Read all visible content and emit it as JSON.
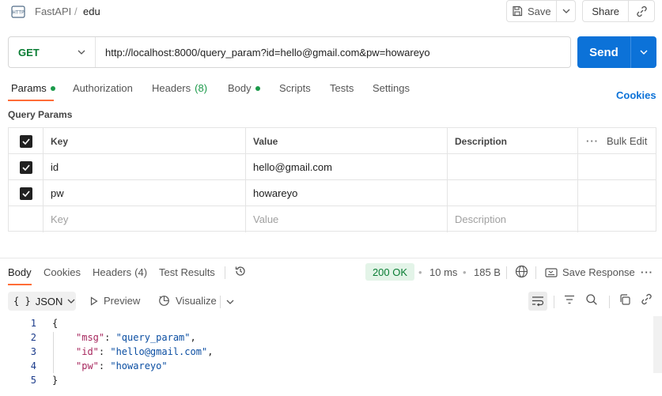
{
  "header": {
    "workspace": "FastAPI",
    "separator": "/",
    "request_name": "edu",
    "save_label": "Save",
    "share_label": "Share"
  },
  "request": {
    "method": "GET",
    "url": "http://localhost:8000/query_param?id=hello@gmail.com&pw=howareyo",
    "send_label": "Send"
  },
  "tabs": {
    "params": "Params",
    "authorization": "Authorization",
    "headers": "Headers",
    "headers_count": "(8)",
    "body": "Body",
    "scripts": "Scripts",
    "tests": "Tests",
    "settings": "Settings",
    "cookies": "Cookies"
  },
  "query_params": {
    "title": "Query Params",
    "columns": {
      "key": "Key",
      "value": "Value",
      "description": "Description",
      "bulk_edit": "Bulk Edit"
    },
    "rows": [
      {
        "key": "id",
        "value": "hello@gmail.com",
        "description": "",
        "checked": true
      },
      {
        "key": "pw",
        "value": "howareyo",
        "description": "",
        "checked": true
      }
    ],
    "placeholders": {
      "key": "Key",
      "value": "Value",
      "description": "Description"
    }
  },
  "response": {
    "tabs": {
      "body": "Body",
      "cookies": "Cookies",
      "headers": "Headers",
      "headers_count": "(4)",
      "test_results": "Test Results"
    },
    "status": "200 OK",
    "time": "10 ms",
    "size": "185 B",
    "save_response": "Save Response",
    "format": "JSON",
    "format_prefix": "{ }",
    "preview_label": "Preview",
    "visualize_label": "Visualize",
    "lines": [
      {
        "n": "1",
        "text": "{"
      },
      {
        "n": "2",
        "key": "\"msg\"",
        "value": "\"query_param\"",
        "comma": ","
      },
      {
        "n": "3",
        "key": "\"id\"",
        "value": "\"hello@gmail.com\"",
        "comma": ","
      },
      {
        "n": "4",
        "key": "\"pw\"",
        "value": "\"howareyo\"",
        "comma": ""
      },
      {
        "n": "5",
        "text": "}"
      }
    ]
  },
  "colors": {
    "accent": "#0c72d8",
    "method_get": "#0a7d34",
    "tab_underline": "#ff6c37",
    "status_ok_bg": "#e3f4e8"
  }
}
